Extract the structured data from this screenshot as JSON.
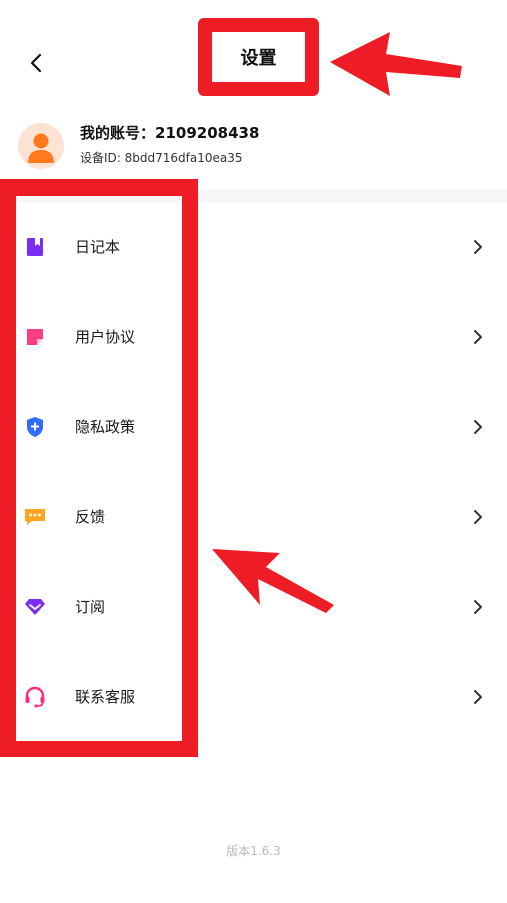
{
  "header": {
    "title": "设置"
  },
  "profile": {
    "account_label": "我的账号：",
    "account_number": "2109208438",
    "device_label": "设备ID: ",
    "device_id": "8bdd716dfa10ea35"
  },
  "menu": {
    "items": [
      {
        "label": "日记本",
        "icon": "notebook-icon",
        "color": "#7b2cf5"
      },
      {
        "label": "用户协议",
        "icon": "note-icon",
        "color": "#ff3d7f"
      },
      {
        "label": "隐私政策",
        "icon": "shield-plus-icon",
        "color": "#2f6bff"
      },
      {
        "label": "反馈",
        "icon": "chat-bubble-icon",
        "color": "#ffa51f"
      },
      {
        "label": "订阅",
        "icon": "diamond-icon",
        "color": "#7b2cf5"
      },
      {
        "label": "联系客服",
        "icon": "headset-icon",
        "color": "#ff2d78"
      }
    ]
  },
  "footer": {
    "version": "版本1.6.3"
  },
  "colors": {
    "annotation_red": "#ee1c25",
    "divider": "#f6f6f6",
    "version_text": "#bbbbbb"
  }
}
